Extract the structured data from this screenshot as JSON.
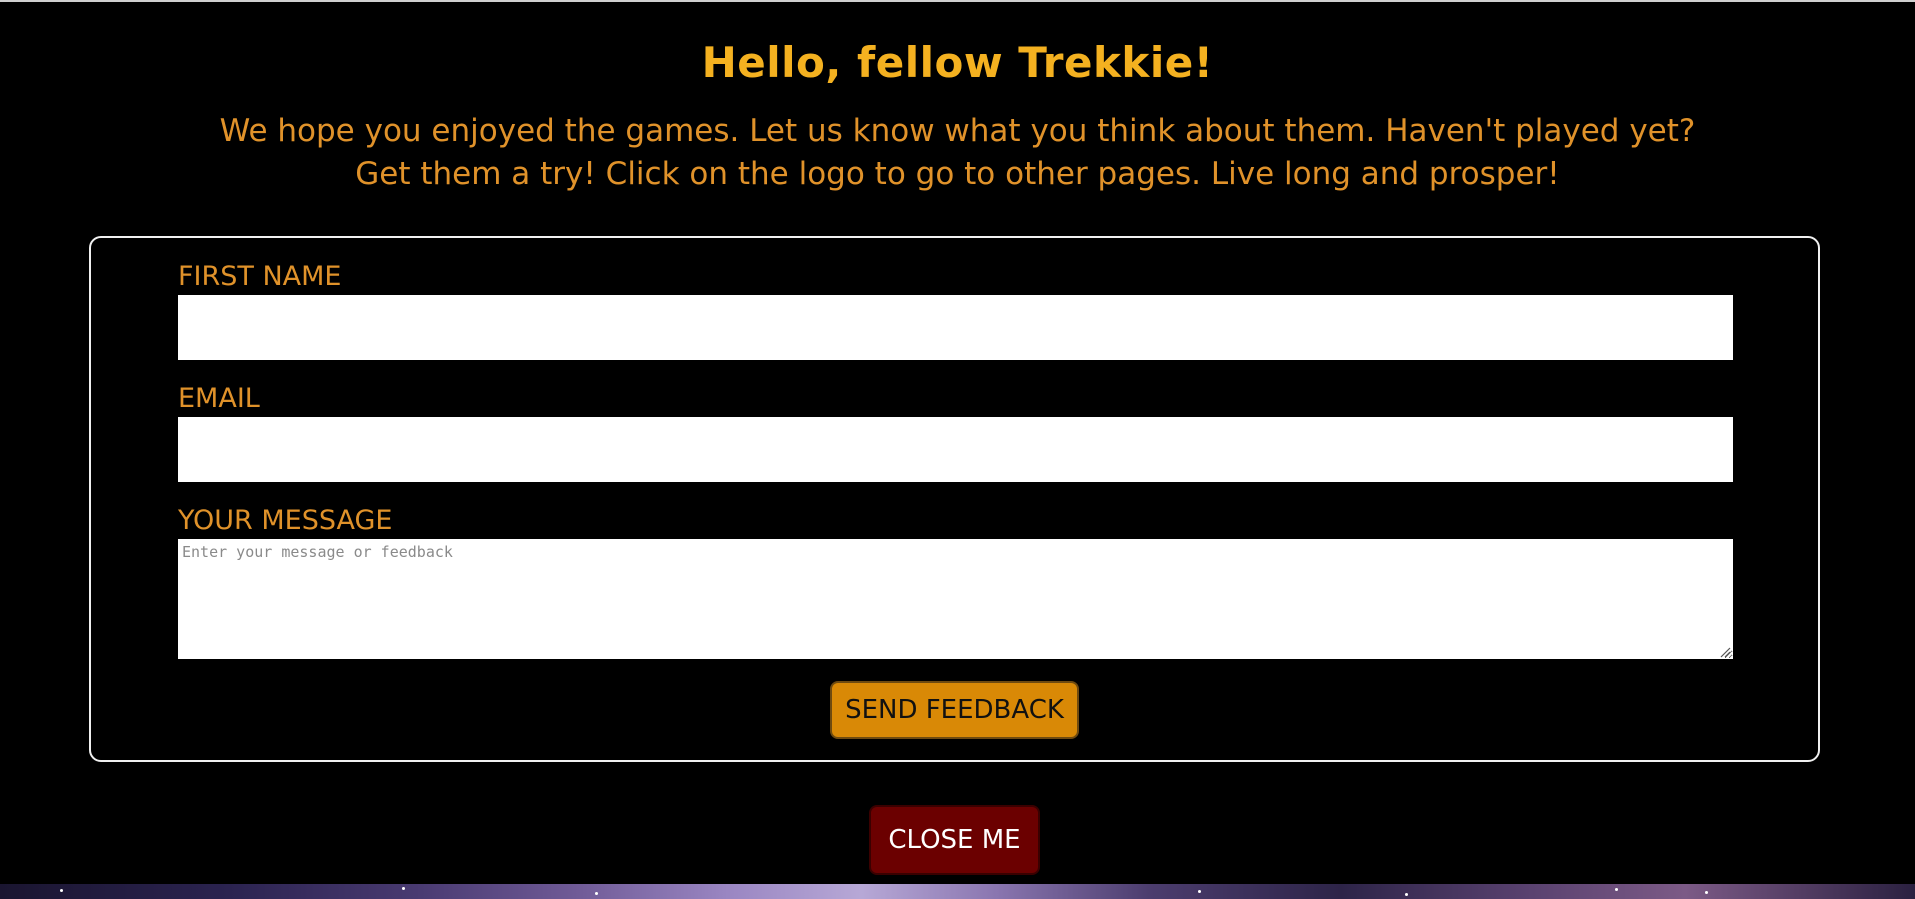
{
  "modal": {
    "heading": "Hello, fellow Trekkie!",
    "intro_line1": "We hope you enjoyed the games. Let us know what you think about them. Haven't played yet?",
    "intro_line2": "Get them a try! Click on the logo to go to other pages. Live long and prosper!"
  },
  "form": {
    "first_name_label": "FIRST NAME",
    "first_name_value": "",
    "email_label": "EMAIL",
    "email_value": "",
    "message_label": "YOUR MESSAGE",
    "message_placeholder": "Enter your message or feedback",
    "message_value": "",
    "send_label": "SEND FEEDBACK"
  },
  "close_label": "CLOSE ME",
  "colors": {
    "background": "#000000",
    "heading": "#f4b120",
    "text_accent": "#e0922a",
    "send_button": "#d98906",
    "close_button": "#6b0000"
  }
}
